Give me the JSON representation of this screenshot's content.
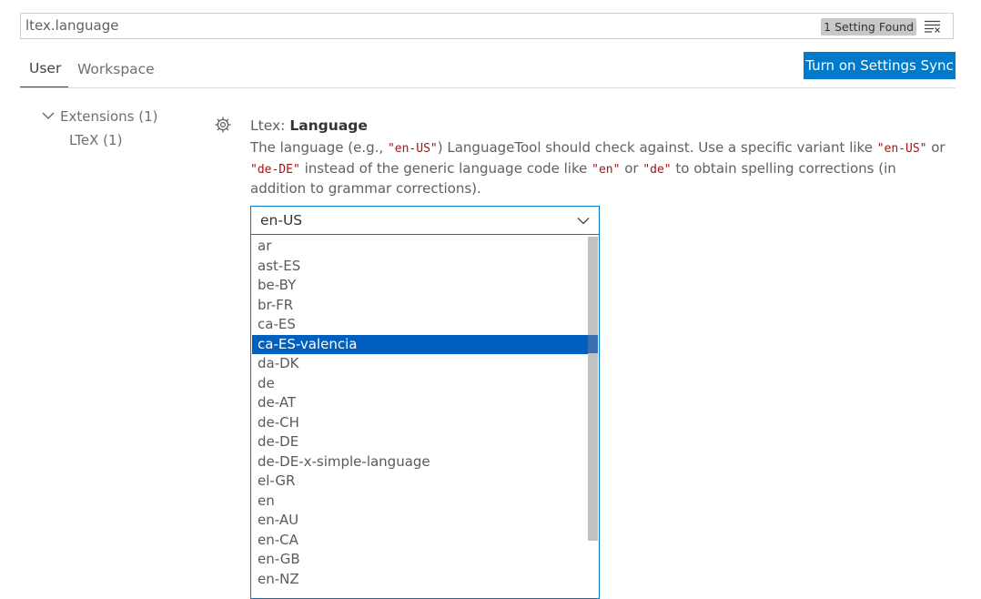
{
  "search": {
    "value": "ltex.language",
    "result_count": "1 Setting Found",
    "clear_icon": "clear-filter-icon"
  },
  "tabs": [
    {
      "label": "User",
      "active": true
    },
    {
      "label": "Workspace",
      "active": false
    }
  ],
  "sync_button": {
    "label": "Turn on Settings Sync",
    "color": "#007acc"
  },
  "toc": {
    "extensions_label": "Extensions (1)",
    "ltex_label": "LTeX (1)"
  },
  "setting": {
    "category": "Ltex: ",
    "name": "Language",
    "desc": {
      "t1": "The language (e.g., ",
      "c1": "\"en-US\"",
      "t2": ") LanguageTool should check against. Use a specific variant like ",
      "c2": "\"en-US\"",
      "t3": " or ",
      "c3": "\"de-DE\"",
      "t4": " instead of the generic language code like ",
      "c4": "\"en\"",
      "t5": " or ",
      "c5": "\"de\"",
      "t6": " to obtain spelling corrections (in addition to grammar corrections)."
    },
    "selected_value": "en-US"
  },
  "dropdown": {
    "highlighted": "ca-ES-valencia",
    "highlight_color": "#0060c0",
    "options": [
      "ar",
      "ast-ES",
      "be-BY",
      "br-FR",
      "ca-ES",
      "ca-ES-valencia",
      "da-DK",
      "de",
      "de-AT",
      "de-CH",
      "de-DE",
      "de-DE-x-simple-language",
      "el-GR",
      "en",
      "en-AU",
      "en-CA",
      "en-GB",
      "en-NZ"
    ]
  }
}
